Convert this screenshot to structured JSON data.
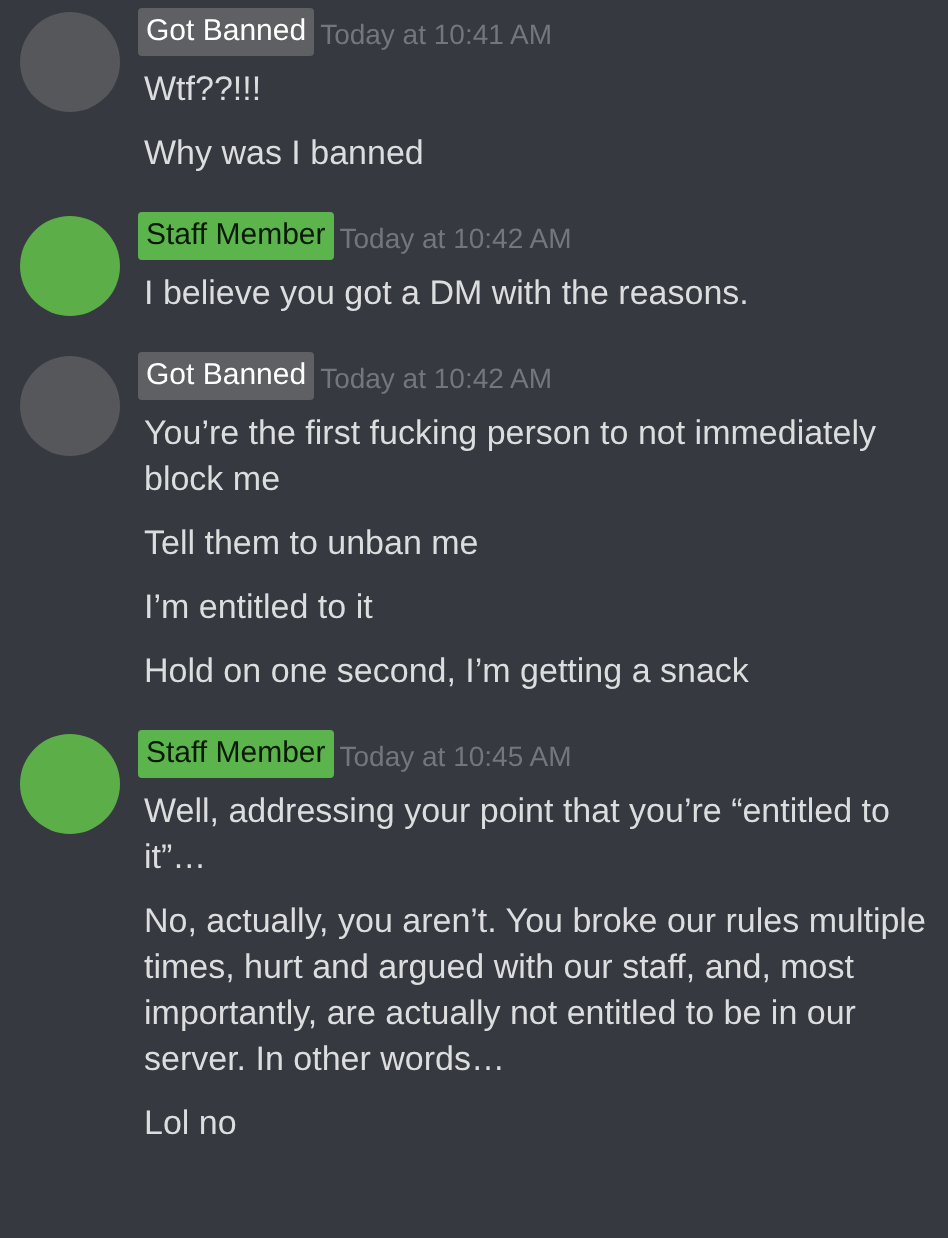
{
  "groups": [
    {
      "author": "Got Banned",
      "kind": "member",
      "timestamp": "Today at 10:41 AM",
      "messages": [
        "Wtf??!!!",
        "Why was I banned"
      ]
    },
    {
      "author": "Staff Member",
      "kind": "staff",
      "timestamp": "Today at 10:42 AM",
      "messages": [
        "I believe you got a DM with the reasons."
      ]
    },
    {
      "author": "Got Banned",
      "kind": "member",
      "timestamp": "Today at 10:42 AM",
      "messages": [
        "You’re the first fucking person to not immediately block me",
        "Tell them to unban me",
        "I’m entitled to it",
        "Hold on one second, I’m getting a snack"
      ]
    },
    {
      "author": "Staff Member",
      "kind": "staff",
      "timestamp": "Today at 10:45 AM",
      "messages": [
        "Well, addressing your point that you’re “entitled to it”…",
        "No, actually, you aren’t. You broke our rules multiple times, hurt and argued with our staff, and, most importantly, are actually not entitled to be in our server. In other words…",
        "Lol no"
      ]
    }
  ]
}
